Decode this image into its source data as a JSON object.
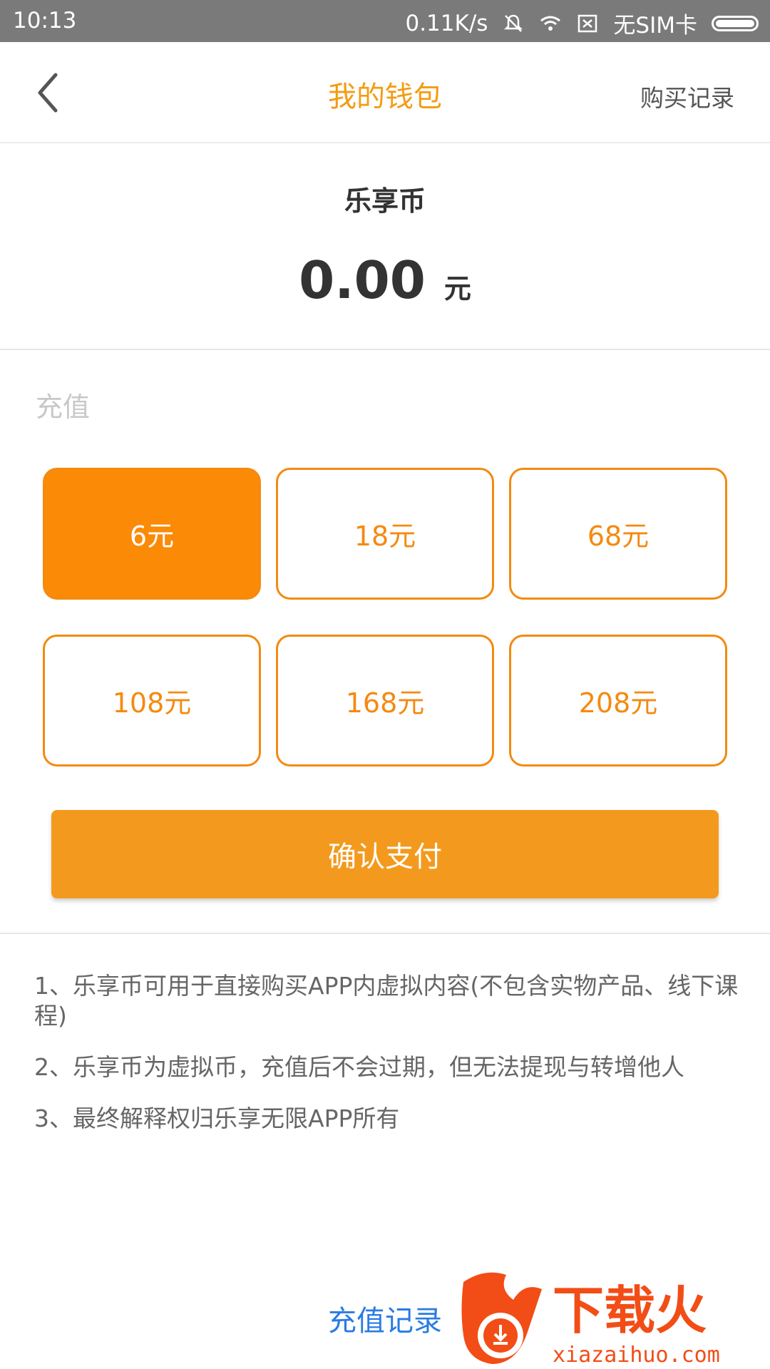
{
  "status_bar": {
    "time": "10:13",
    "speed": "0.11K/s",
    "sim": "无SIM卡"
  },
  "nav": {
    "title": "我的钱包",
    "right_link": "购买记录"
  },
  "balance": {
    "currency_name": "乐享币",
    "amount": "0.00",
    "unit": "元"
  },
  "recharge": {
    "label": "充值",
    "options": [
      "6元",
      "18元",
      "68元",
      "108元",
      "168元",
      "208元"
    ],
    "selected_index": 0
  },
  "pay_button": "确认支付",
  "notes": [
    "1、乐享币可用于直接购买APP内虚拟内容(不包含实物产品、线下课程)",
    "2、乐享币为虚拟币，充值后不会过期，但无法提现与转增他人",
    "3、最终解释权归乐享无限APP所有"
  ],
  "recharge_records": "充值记录",
  "watermark": {
    "brand": "下载火",
    "url": "xiazaihuo.com"
  },
  "colors": {
    "accent": "#f48a10",
    "status_bar": "#7a7a7a",
    "link_blue": "#2a7be4"
  }
}
